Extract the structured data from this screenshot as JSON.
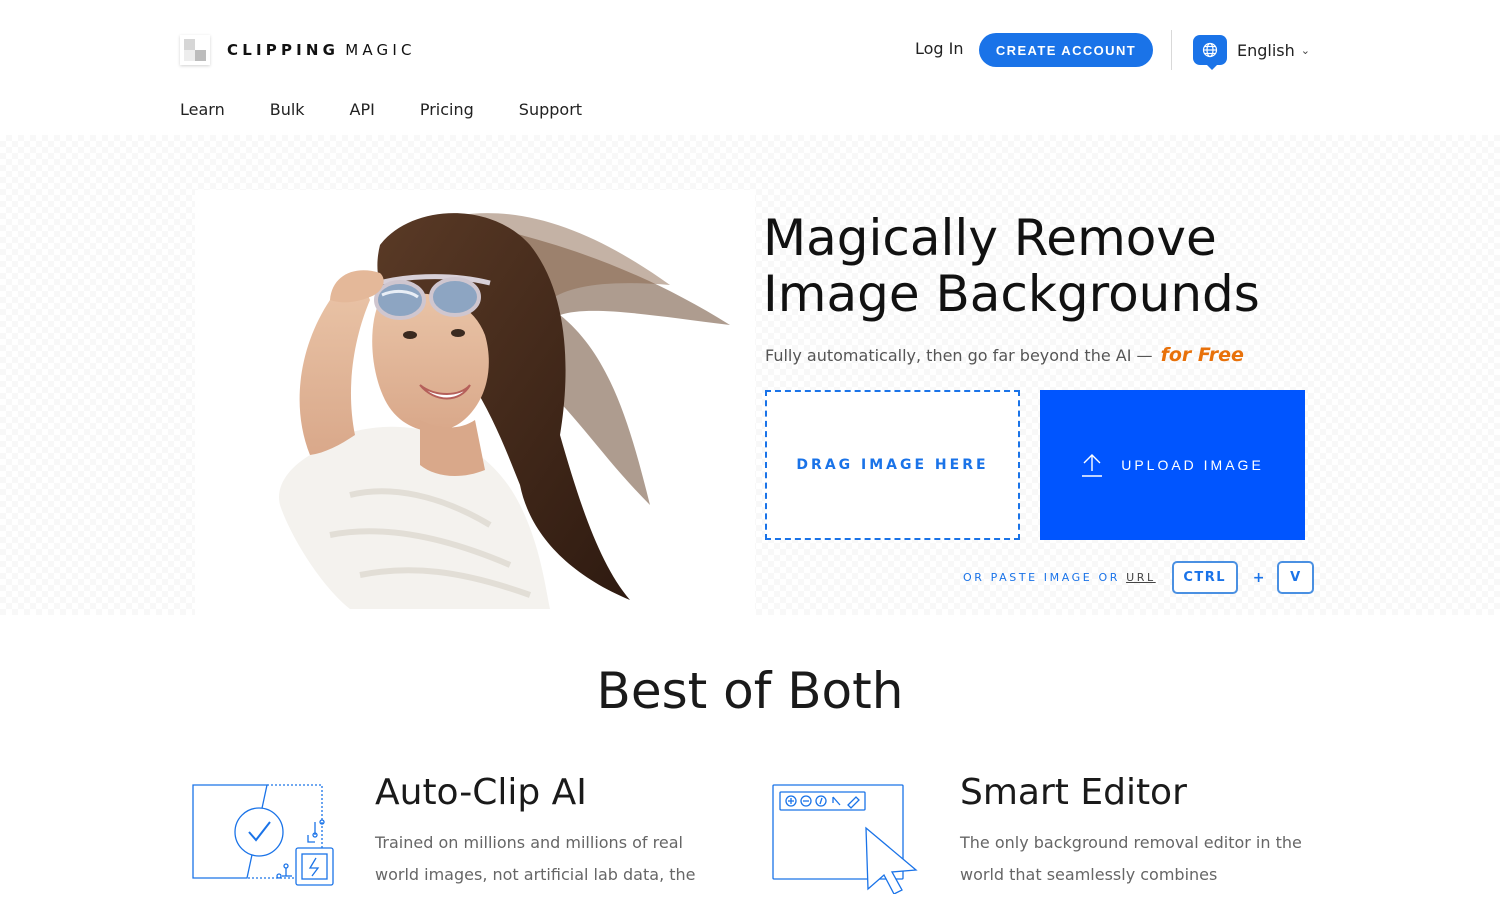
{
  "header": {
    "logo_bold": "CLIPPING",
    "logo_light": "MAGIC",
    "login_label": "Log In",
    "create_account_label": "CREATE ACCOUNT",
    "language_label": "English"
  },
  "nav": {
    "items": [
      {
        "label": "Learn"
      },
      {
        "label": "Bulk"
      },
      {
        "label": "API"
      },
      {
        "label": "Pricing"
      },
      {
        "label": "Support"
      }
    ]
  },
  "hero": {
    "title_line1": "Magically Remove",
    "title_line2": "Image Backgrounds",
    "subtitle": "Fully automatically, then go far beyond the AI —",
    "subtitle_highlight": "for Free",
    "drop_label": "DRAG IMAGE HERE",
    "upload_label": "UPLOAD IMAGE",
    "paste_text": "OR PASTE IMAGE OR",
    "paste_link": "URL",
    "key_ctrl": "CTRL",
    "key_plus": "+",
    "key_v": "V"
  },
  "section": {
    "title": "Best of Both"
  },
  "features": [
    {
      "title": "Auto-Clip AI",
      "body": "Trained on millions and millions of real world images, not artificial lab data, the",
      "icon": "ai-check-icon"
    },
    {
      "title": "Smart Editor",
      "body": "The only background removal editor in the world that seamlessly combines",
      "icon": "editor-cursor-icon"
    }
  ],
  "colors": {
    "accent": "#1a73e8",
    "upload_blue": "#0055ff",
    "highlight_orange": "#e8710a"
  }
}
